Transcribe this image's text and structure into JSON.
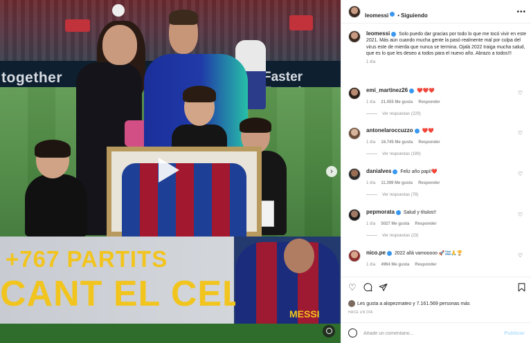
{
  "media": {
    "ad_left": "together",
    "ad_right": "Faster Togethe",
    "banner_line1": "+767 PARTITS",
    "banner_line2": "CANT EL CEL",
    "jersey_name": "MESSI"
  },
  "header": {
    "username": "leomessi",
    "separator": "•",
    "follow_status": "Siguiendo",
    "more": "•••"
  },
  "caption": {
    "username": "leomessi",
    "text": "Solo puedo dar gracias por todo lo que me tocó vivir en este 2021. Más aún cuando mucha gente la pasó realmente mal por culpa del virus este de mierda que nunca se termina. Ojalá 2022 traiga mucha salud, que es lo que les deseo a todos para el nuevo año. Abrazo a todos!!!",
    "time": "1 día"
  },
  "comments": [
    {
      "username": "emi_martinez26",
      "text": "❤️❤️❤️",
      "time": "1 día",
      "likes": "21.055 Me gusta",
      "reply": "Responder",
      "replies": "Ver respuestas (229)"
    },
    {
      "username": "antonelaroccuzzo",
      "text": "❤️❤️",
      "time": "1 día",
      "likes": "16.745 Me gusta",
      "reply": "Responder",
      "replies": "Ver respuestas (189)"
    },
    {
      "username": "danialves",
      "text": "Feliz año papi!❤️",
      "time": "1 día",
      "likes": "11.399 Me gusta",
      "reply": "Responder",
      "replies": "Ver respuestas (78)"
    },
    {
      "username": "pepmorata",
      "text": "Salud y títulos!!",
      "time": "1 día",
      "likes": "5027 Me gusta",
      "reply": "Responder",
      "replies": "Ver respuestas (23)"
    },
    {
      "username": "nico.pe",
      "text": "2022 allá vamooooo 🚀🇦🇷🙏🏆",
      "time": "1 día",
      "likes": "4964 Me gusta",
      "reply": "Responder",
      "replies": ""
    }
  ],
  "actions": {
    "likes_text": "Les gusta a alopezmateo y 7.161.569 personas más",
    "date": "HACE UN DÍA"
  },
  "add_comment": {
    "placeholder": "Añade un comentario...",
    "publish": "Publicar"
  },
  "colors": {
    "verified": "#3897f0",
    "meta_gray": "#8e8e8e",
    "publish_disabled": "#b2dffc",
    "banner_yellow": "#f2c41e"
  }
}
